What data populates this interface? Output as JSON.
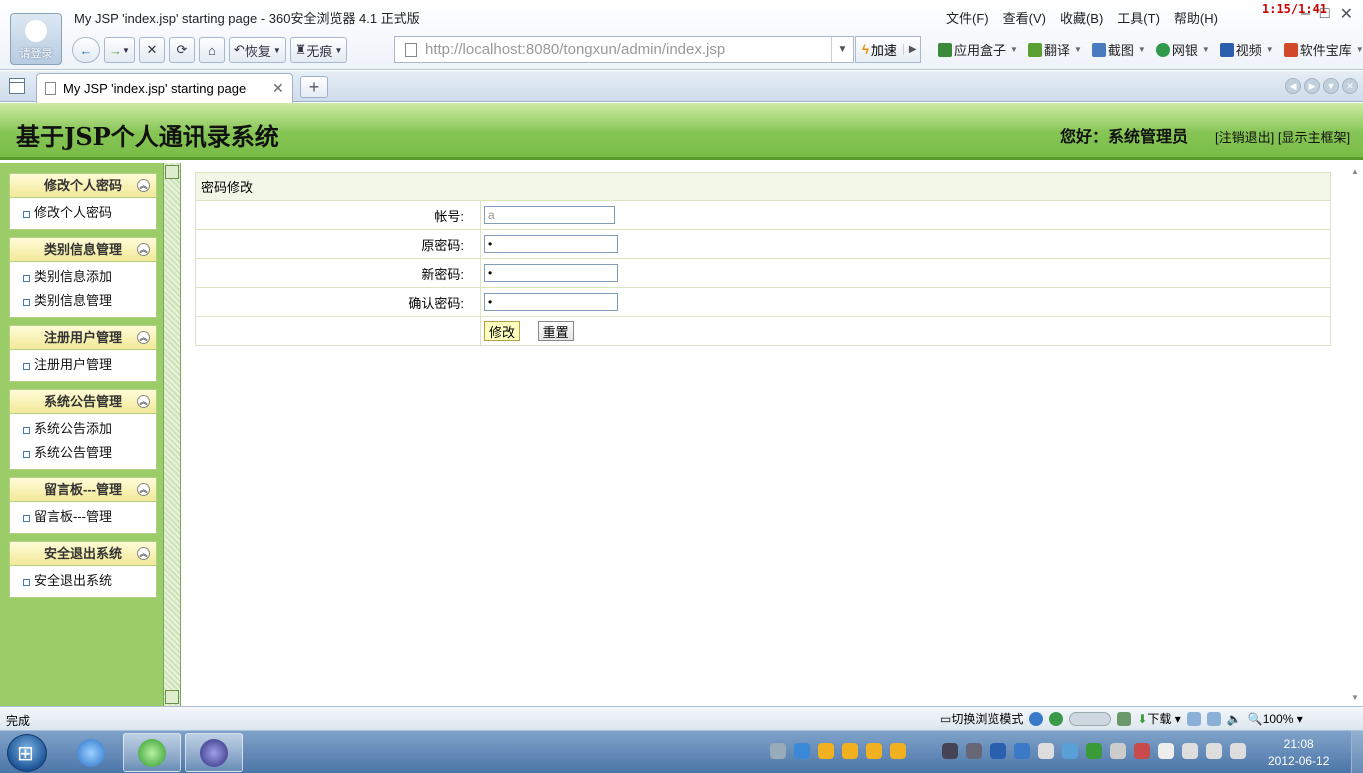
{
  "browser": {
    "window_title": "My JSP 'index.jsp' starting page - 360安全浏览器 4.1 正式版",
    "login_label": "请登录",
    "timer": "1:15/1:41",
    "menu": [
      "文件(F)",
      "查看(V)",
      "收藏(B)",
      "工具(T)",
      "帮助(H)"
    ],
    "nav": {
      "restore": "恢复",
      "privacy": "无痕"
    },
    "address_url": "http://localhost:8080/tongxun/admin/index.jsp",
    "speed_label": "加速",
    "tools": [
      {
        "label": "应用盒子",
        "icon": "app-box-icon",
        "color": "#3a8a3a"
      },
      {
        "label": "翻译",
        "icon": "translate-icon",
        "color": "#5aa030"
      },
      {
        "label": "截图",
        "icon": "screenshot-icon",
        "color": "#4a7ac0"
      },
      {
        "label": "网银",
        "icon": "ebank-icon",
        "color": "#2e9a4a"
      },
      {
        "label": "视频",
        "icon": "video-icon",
        "color": "#2a5fb0"
      },
      {
        "label": "软件宝库",
        "icon": "software-icon",
        "color": "#d04a2a"
      }
    ],
    "tab_title": "My JSP 'index.jsp' starting page"
  },
  "page": {
    "system_title": "基于JSP个人通讯录系统",
    "greeting": "您好：系统管理员",
    "logout_link": "[注销退出]",
    "show_frame_link": "[显示主框架]"
  },
  "sidebar": {
    "groups": [
      {
        "title": "修改个人密码",
        "items": [
          "修改个人密码"
        ]
      },
      {
        "title": "类别信息管理",
        "items": [
          "类别信息添加",
          "类别信息管理"
        ]
      },
      {
        "title": "注册用户管理",
        "items": [
          "注册用户管理"
        ]
      },
      {
        "title": "系统公告管理",
        "items": [
          "系统公告添加",
          "系统公告管理"
        ]
      },
      {
        "title": "留言板---管理",
        "items": [
          "留言板---管理"
        ]
      },
      {
        "title": "安全退出系统",
        "items": [
          "安全退出系统"
        ]
      }
    ]
  },
  "form": {
    "title": "密码修改",
    "account_label": "帐号:",
    "account_value": "a",
    "old_pw_label": "原密码:",
    "old_pw_value": "•",
    "new_pw_label": "新密码:",
    "new_pw_value": "•",
    "confirm_pw_label": "确认密码:",
    "confirm_pw_value": "•",
    "submit_label": "修改",
    "reset_label": "重置"
  },
  "statusbar": {
    "text": "完成",
    "mode_label": "切换浏览模式",
    "download_label": "下载",
    "zoom": "100%"
  },
  "taskbar": {
    "time": "21:08",
    "date": "2012-06-12"
  }
}
